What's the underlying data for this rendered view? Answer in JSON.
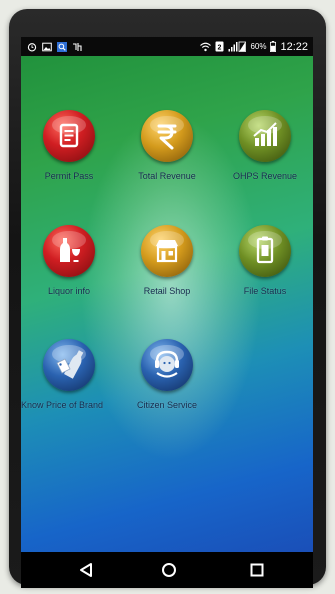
{
  "status_bar": {
    "battery_percent": "60%",
    "time": "12:22",
    "icons": [
      "alarm-icon",
      "image-icon",
      "search-icon",
      "notification-icon",
      "wifi-icon",
      "sim-icon",
      "signal-icon",
      "battery-icon"
    ]
  },
  "tiles": [
    {
      "label": "Permit Pass",
      "icon": "document-icon",
      "color": "#b0151c"
    },
    {
      "label": "Total Revenue",
      "icon": "rupee-icon",
      "color": "#b07a14"
    },
    {
      "label": "OHPS Revenue",
      "icon": "bar-chart-icon",
      "color": "#5c7a1a"
    },
    {
      "label": "Liquor info",
      "icon": "liquor-icon",
      "color": "#b0151c"
    },
    {
      "label": "Retail Shop",
      "icon": "shop-icon",
      "color": "#b07a14"
    },
    {
      "label": "File Status",
      "icon": "file-status-icon",
      "color": "#5c7a1a"
    },
    {
      "label": "Know Price of Brand",
      "icon": "price-tag-icon",
      "color": "#1f4f8f"
    },
    {
      "label": "Citizen Service",
      "icon": "citizen-service-icon",
      "color": "#1f4f8f"
    }
  ],
  "nav": {
    "icons": [
      "back-icon",
      "home-icon",
      "recents-icon"
    ]
  }
}
